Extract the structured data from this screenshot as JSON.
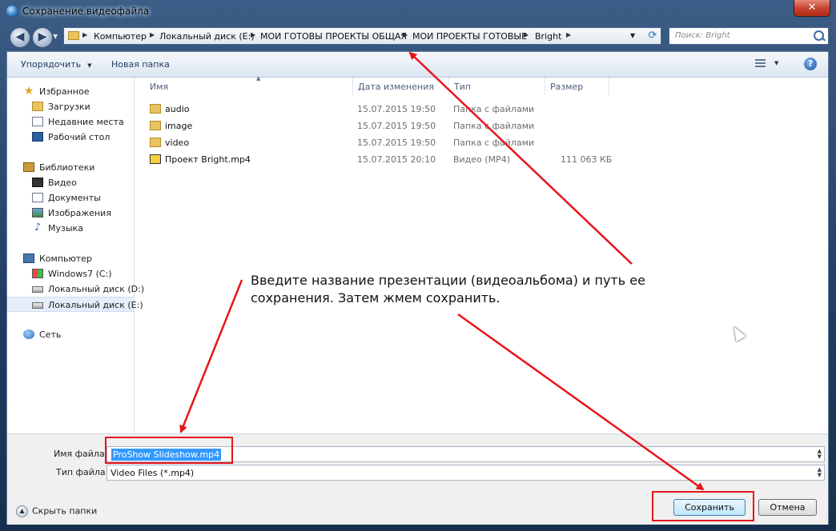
{
  "window": {
    "title": "Сохранение видеофайла",
    "close_glyph": "✕"
  },
  "nav": {
    "back_glyph": "◀",
    "forward_glyph": "▶"
  },
  "address": {
    "crumbs": [
      "Компьютер",
      "Локальный диск (E:)",
      "МОИ ГОТОВЫ ПРОЕКТЫ ОБЩАЯ",
      "МОИ ПРОЕКТЫ ГОТОВЫЕ",
      "Bright"
    ]
  },
  "search": {
    "placeholder": "Поиск: Bright"
  },
  "toolbar": {
    "organize_label": "Упорядочить",
    "new_folder_label": "Новая папка"
  },
  "sidebar": {
    "favorites": {
      "label": "Избранное",
      "items": [
        "Загрузки",
        "Недавние места",
        "Рабочий стол"
      ]
    },
    "libraries": {
      "label": "Библиотеки",
      "items": [
        "Видео",
        "Документы",
        "Изображения",
        "Музыка"
      ]
    },
    "computer": {
      "label": "Компьютер",
      "items": [
        "Windows7 (C:)",
        "Локальный диск (D:)",
        "Локальный диск (E:)"
      ]
    },
    "network": {
      "label": "Сеть"
    }
  },
  "columns": {
    "name": "Имя",
    "date": "Дата изменения",
    "type": "Тип",
    "size": "Размер"
  },
  "files": [
    {
      "name": "audio",
      "date": "15.07.2015 19:50",
      "type": "Папка с файлами",
      "size": "",
      "icon": "folder-icon"
    },
    {
      "name": "image",
      "date": "15.07.2015 19:50",
      "type": "Папка с файлами",
      "size": "",
      "icon": "folder-icon"
    },
    {
      "name": "video",
      "date": "15.07.2015 19:50",
      "type": "Папка с файлами",
      "size": "",
      "icon": "folder-icon"
    },
    {
      "name": "Проект Bright.mp4",
      "date": "15.07.2015 20:10",
      "type": "Видео (MP4)",
      "size": "111 063 КБ",
      "icon": "mp4-file-icon"
    }
  ],
  "form": {
    "filename_label": "Имя файла:",
    "filename_value": "ProShow Slideshow.mp4",
    "filetype_label": "Тип файла:",
    "filetype_value": "Video Files (*.mp4)"
  },
  "footer": {
    "hide_folders_label": "Скрыть папки",
    "save_label": "Сохранить",
    "cancel_label": "Отмена"
  },
  "annotation": {
    "instruction": "Введите название презентации (видеоальбома) и путь ее сохранения. Затем жмем сохранить.",
    "color": "#e8141b"
  }
}
